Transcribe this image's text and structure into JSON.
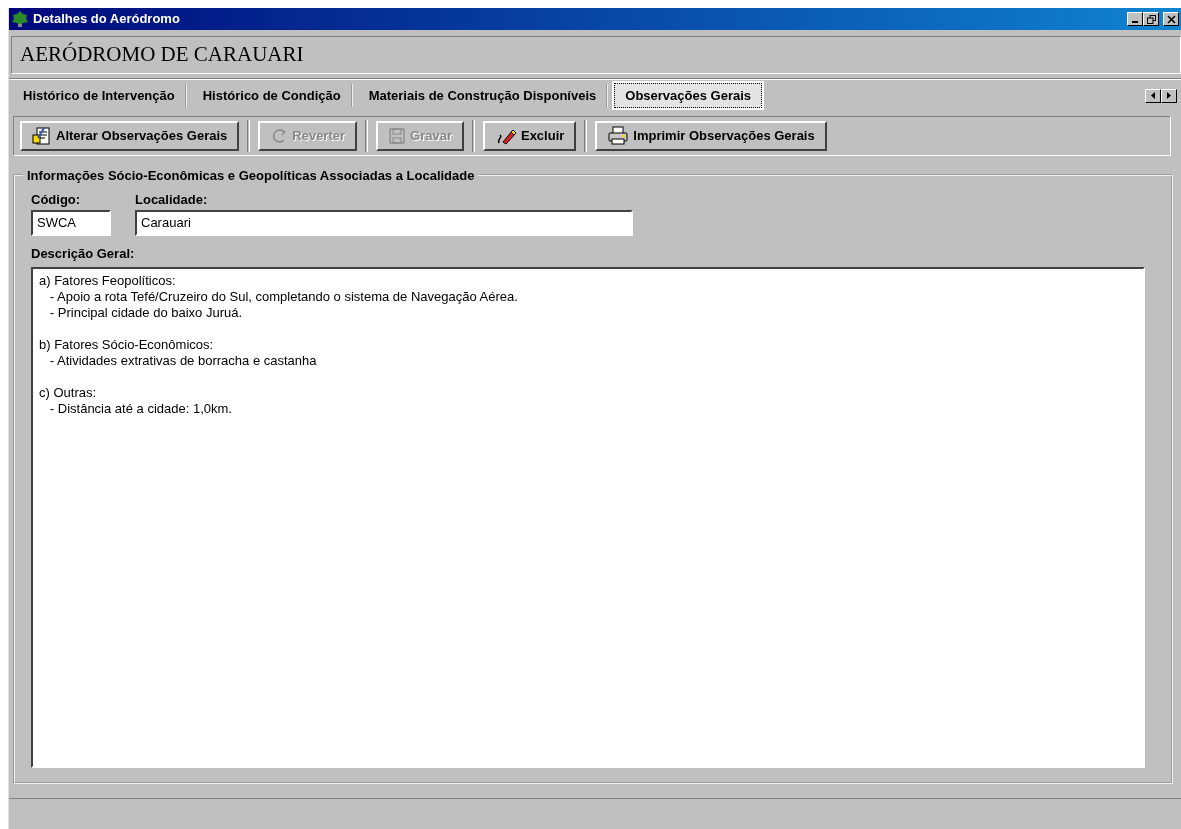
{
  "window": {
    "title": "Detalhes do Aeródromo"
  },
  "heading": "AERÓDROMO DE CARAUARI",
  "tabs": [
    {
      "label": "Histórico de Intervenção",
      "selected": false
    },
    {
      "label": "Histórico de Condição",
      "selected": false
    },
    {
      "label": "Materiais de Construção Disponíveis",
      "selected": false
    },
    {
      "label": "Observações Gerais",
      "selected": true
    }
  ],
  "toolbar": [
    {
      "label": "Alterar Observações Gerais",
      "kind": "edit",
      "disabled": false
    },
    {
      "label": "Reverter",
      "kind": "revert",
      "disabled": true
    },
    {
      "label": "Gravar",
      "kind": "save",
      "disabled": true
    },
    {
      "label": "Excluir",
      "kind": "delete",
      "disabled": false
    },
    {
      "label": "Imprimir Observações Gerais",
      "kind": "print",
      "disabled": false
    }
  ],
  "group": {
    "title": "Informações Sócio-Econômicas e Geopolíticas Associadas a Localidade",
    "codigo": {
      "label": "Código:",
      "value": "SWCA"
    },
    "localidade": {
      "label": "Localidade:",
      "value": "Carauari"
    },
    "descricao": {
      "label": "Descrição Geral:",
      "paragraphs": [
        [
          "a) Fatores Feopolíticos:",
          "   - Apoio a rota Tefé/Cruzeiro do Sul, completando o sistema de Navegação Aérea.",
          "   - Principal cidade do baixo Juruá."
        ],
        [
          "b) Fatores Sócio-Econômicos:",
          "   - Atividades extrativas de borracha e castanha"
        ],
        [
          "c) Outras:",
          "   - Distância até a cidade: 1,0km."
        ]
      ]
    }
  }
}
